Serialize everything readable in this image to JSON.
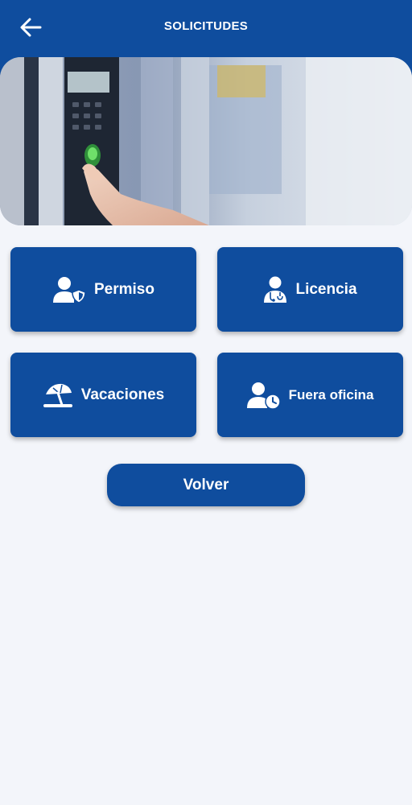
{
  "header": {
    "title": "SOLICITUDES",
    "back_icon": "arrow-left-icon"
  },
  "banner": {
    "image": "fingerprint-scanner-photo"
  },
  "options": [
    {
      "label": "Permiso",
      "icon": "user-shield-icon"
    },
    {
      "label": "Licencia",
      "icon": "user-doctor-icon"
    },
    {
      "label": "Vacaciones",
      "icon": "umbrella-beach-icon"
    },
    {
      "label": "Fuera oficina",
      "icon": "user-clock-icon"
    }
  ],
  "actions": {
    "volver_label": "Volver"
  },
  "colors": {
    "primary": "#0f4d9e",
    "background": "#f3f5fa",
    "text_on_primary": "#ffffff"
  }
}
